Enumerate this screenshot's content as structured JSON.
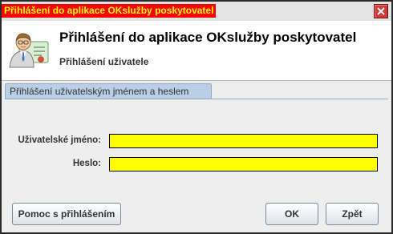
{
  "window": {
    "title": "Přihlášení do aplikace OKslužby poskytovatel"
  },
  "header": {
    "title": "Přihlášení do aplikace OKslužby poskytovatel",
    "subtitle": "Přihlášení uživatele",
    "icon": "user-id-card-icon"
  },
  "tab": {
    "label": "Přihlášení uživatelským jménem a heslem"
  },
  "form": {
    "username_label": "Uživatelské jméno:",
    "username_value": "",
    "password_label": "Heslo:",
    "password_value": ""
  },
  "buttons": {
    "help_label": "Pomoc s přihlášením",
    "ok_label": "OK",
    "back_label": "Zpět"
  },
  "colors": {
    "title_bg": "#ff0000",
    "title_fg": "#ffff00",
    "input_bg": "#ffff00",
    "tab_bg": "#b8cfe5"
  }
}
